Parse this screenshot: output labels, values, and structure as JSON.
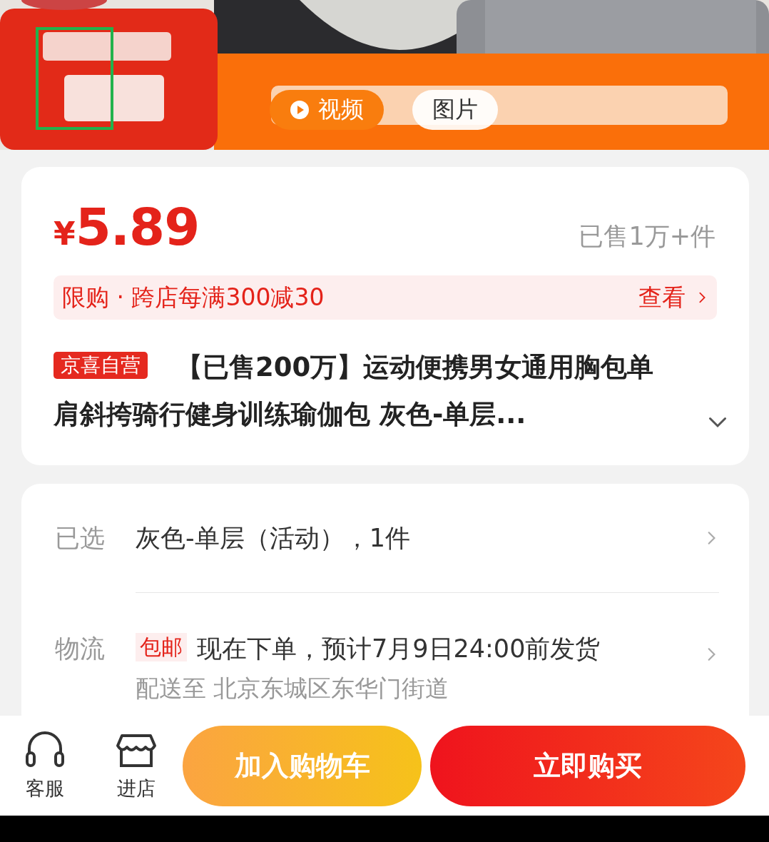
{
  "media_tabs": [
    {
      "label": "视频",
      "kind": "video",
      "selected": true
    },
    {
      "label": "图片",
      "selected": false
    }
  ],
  "price": {
    "currency": "¥",
    "amount": "5.89",
    "sold": "已售1万+件"
  },
  "promo": {
    "text": "限购 · 跨店每满300减30",
    "action": "查看"
  },
  "product": {
    "badge": "京喜自营",
    "title": "【已售200万】运动便携男女通用胸包单肩斜挎骑行健身训练瑜伽包 灰色-单层...",
    "expanded": false
  },
  "options": [
    {
      "label": "已选",
      "kind": "selection",
      "value": "灰色-单层（活动），1件"
    },
    {
      "label": "物流",
      "kind": "shipping",
      "tag": "包邮",
      "value": "现在下单，预计7月9日24:00前发货",
      "note": "配送至 北京东城区东华门街道"
    }
  ],
  "actions": [
    {
      "label": "客服",
      "kind": "service"
    },
    {
      "label": "进店",
      "kind": "store"
    }
  ],
  "buttons": [
    {
      "label": "加入购物车",
      "kind": "cart"
    },
    {
      "label": "立即购买",
      "kind": "buy"
    }
  ]
}
